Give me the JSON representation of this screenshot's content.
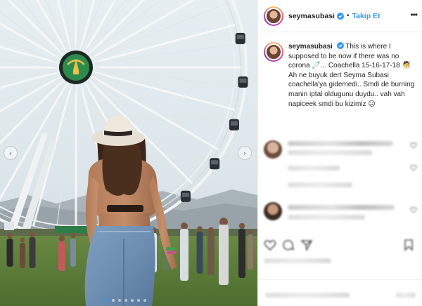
{
  "post": {
    "header": {
      "username": "seymasubasi",
      "separator": "•",
      "follow_label": "Takip Et",
      "more_glyph": "•••"
    },
    "caption": {
      "username": "seymasubasi",
      "line_1": "This is where I supposed to be now if there was no corona",
      "line_2": "... Coachella 15-16-17-18",
      "line_3": "Ah ne buyuk dert Seyma Subasi coachella'ya gidemedi.. Smdi de burning manin iptal oldugunu duydu.. vah vah napiceek smdi bu kizimiz"
    },
    "carousel": {
      "prev_glyph": "‹",
      "next_glyph": "›",
      "slide_count": 7,
      "active_index": 0
    },
    "icons": {
      "verified": "verified-badge-icon",
      "more": "more-options-icon",
      "prev": "chevron-left-icon",
      "next": "chevron-right-icon",
      "like": "heart-icon",
      "comment": "speech-bubble-icon",
      "share": "paper-plane-icon",
      "save": "bookmark-icon"
    },
    "colors": {
      "accent": "#3897f0",
      "text": "#262626",
      "border": "#efefef"
    }
  }
}
